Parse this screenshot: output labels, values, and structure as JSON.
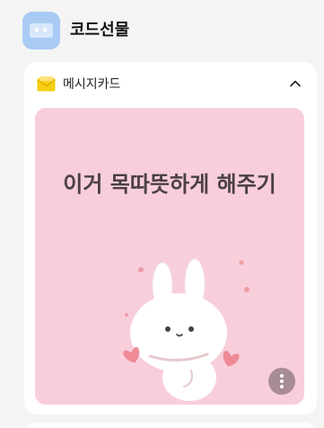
{
  "header": {
    "title": "코드선물",
    "app_icon": "gift-ticket-icon"
  },
  "card": {
    "label": "메시지카드",
    "label_icon": "envelope-icon",
    "toggle_icon": "chevron-up-icon",
    "message": "이거 목따뜻하게 해주기",
    "illustration": "bunny-with-hearts",
    "more_icon": "more-vertical-icon"
  },
  "colors": {
    "app_icon_bg": "#a9cbf3",
    "message_card_bg": "#f9cedb",
    "message_text": "#4a3f45",
    "more_button_bg": "#a78c94",
    "envelope": "#f6cf0f"
  }
}
